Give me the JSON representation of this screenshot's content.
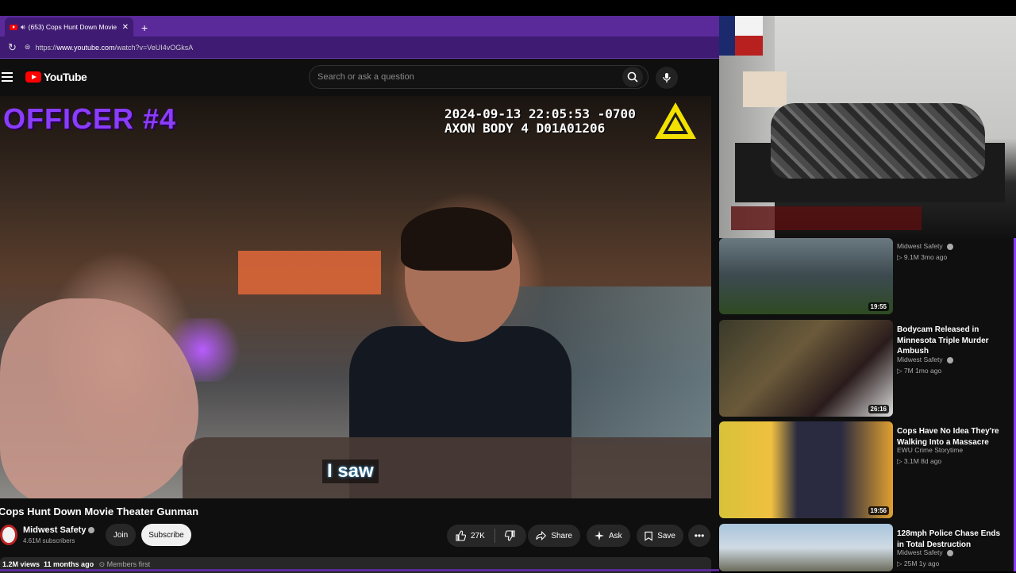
{
  "browser": {
    "tab_title": "(653) Cops Hunt Down Movie",
    "tab_close": "✕",
    "new_tab": "+",
    "url_prefix": "https://",
    "url_host": "www.youtube.com",
    "url_path": "/watch?v=VeUI4vOGksA"
  },
  "youtube": {
    "logo_text": "YouTube",
    "search_placeholder": "Search or ask a question"
  },
  "video": {
    "overlay_officer": "OFFICER #4",
    "axon_line1": "2024-09-13 22:05:53 -0700",
    "axon_line2": "AXON BODY 4 D01A01206",
    "caption": "I saw",
    "title": "Cops Hunt Down Movie Theater Gunman",
    "channel": "Midwest Safety",
    "subscribers": "4.61M subscribers",
    "join_label": "Join",
    "subscribe_label": "Subscribe",
    "likes": "27K",
    "share_label": "Share",
    "ask_label": "Ask",
    "save_label": "Save",
    "views": "1.2M views",
    "age": "11 months ago",
    "members": "Members first"
  },
  "recommendations": [
    {
      "title": "",
      "channel": "Midwest Safety",
      "meta": "9.1M  3mo ago",
      "duration": "19:55"
    },
    {
      "title": "Bodycam Released in Minnesota Triple Murder Ambush",
      "channel": "Midwest Safety",
      "meta": "7M  1mo ago",
      "duration": "26:16"
    },
    {
      "title": "Cops Have No Idea They're Walking Into a Massacre",
      "channel": "EWU Crime Storytime",
      "meta": "3.1M  8d ago",
      "duration": "19:56"
    },
    {
      "title": "128mph Police Chase Ends in Total Destruction",
      "channel": "Midwest Safety",
      "meta": "25M  1y ago",
      "duration": ""
    }
  ],
  "colors": {
    "browser_accent": "#5b2a9a",
    "officer_text": "#8a3dff",
    "youtube_red": "#ff0000"
  }
}
